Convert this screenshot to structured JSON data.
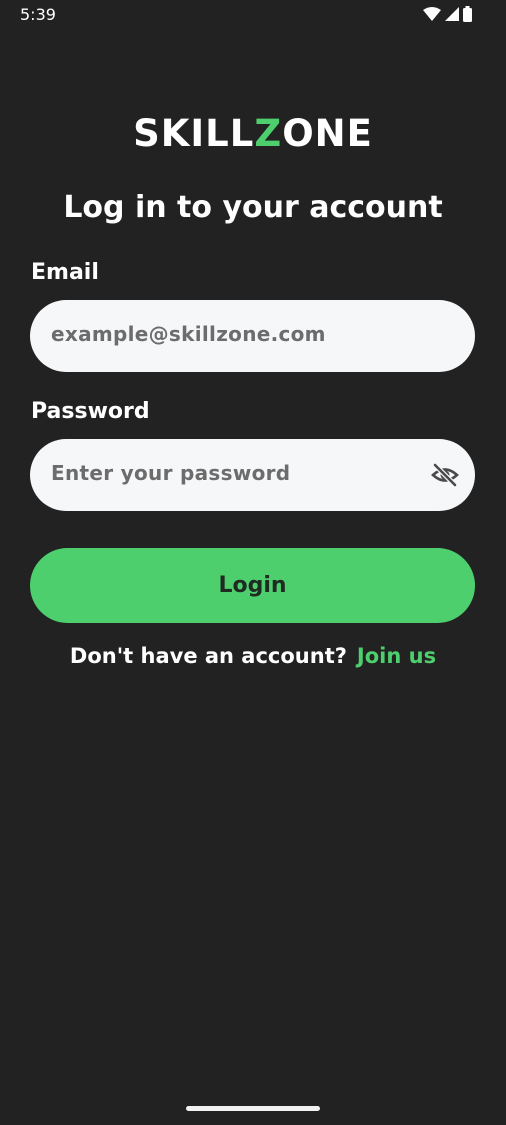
{
  "status_bar": {
    "time": "5:39",
    "icons": [
      "wifi-icon",
      "signal-icon",
      "battery-icon"
    ]
  },
  "brand": {
    "logo_part1": "SKILL",
    "logo_accent": "Z",
    "logo_part2": "ONE",
    "accent_color": "#4ecf6e"
  },
  "page": {
    "heading": "Log in to your account"
  },
  "form": {
    "email_label": "Email",
    "email_placeholder": "example@skillzone.com",
    "password_label": "Password",
    "password_placeholder": "Enter your password",
    "password_toggle_icon": "eye-off-icon",
    "login_label": "Login"
  },
  "footer": {
    "prompt": "Don't have an account?",
    "link": "Join us"
  }
}
